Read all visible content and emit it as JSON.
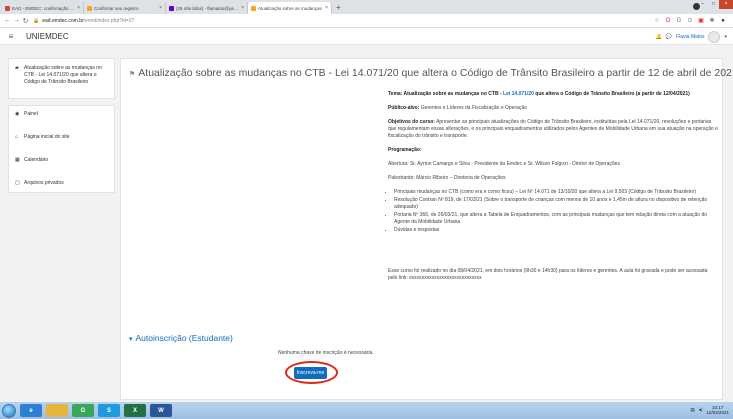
{
  "browser": {
    "tabs": [
      {
        "title": "EAD - EMDEC: confirmação de c",
        "favicon_color": "#d44638",
        "active": false
      },
      {
        "title": "Confirmar seu registro",
        "favicon_color": "#f5a623",
        "active": false
      },
      {
        "title": "(25 não lidos) - flamatos@yahoo",
        "favicon_color": "#5f01d1",
        "active": false
      },
      {
        "title": "Atualização sobre as mudanças",
        "favicon_color": "#f5a623",
        "active": true
      }
    ],
    "new_tab": "+",
    "url_host": "ead.emdec.com.br",
    "url_path": "/enrol/index.php?id=27"
  },
  "navbar": {
    "brand": "UNIEMDEC",
    "user_name": "Flavia Matos"
  },
  "sidebar": {
    "course_item": "Atualização sobre as mudanças no CTB - Lei 14.071/20 que altera o Código de Trânsito Brasileiro",
    "nav_items": [
      {
        "label": "Painel",
        "icon": "dashboard-icon",
        "glyph": "◉"
      },
      {
        "label": "Página inicial do site",
        "icon": "home-icon",
        "glyph": "⌂"
      },
      {
        "label": "Calendário",
        "icon": "calendar-icon",
        "glyph": "▦"
      },
      {
        "label": "Arquivos privados",
        "icon": "file-icon",
        "glyph": "▢"
      }
    ]
  },
  "main": {
    "title": "Atualização sobre as mudanças no CTB - Lei 14.071/20 que altera o Código de Trânsito Brasileiro a partir de 12 de abril de 2021",
    "tema_label": "Tema: Atualização sobre as mudanças no CTB - ",
    "tema_link": "Lei 14.071/20",
    "tema_rest": " que altera o Código de Trânsito Brasileiro (a partir de 12/04/2021)",
    "publico_label": "Público-alvo:",
    "publico_text": " Gerentes e Líderes da Fiscalização e Operação",
    "objetivos_label": "Objetivos do curso:",
    "objetivos_text": " Apresentar as principais atualizações do Código de Trânsito Brasileiro, instituídas pela Lei 14.071/20, resoluções e portarias que regulamentam essas alterações, e os principais enquadramentos utilizados pelos Agentes de Mobilidade Urbana em sua atuação na operação e fiscalização do trânsito e transporte.",
    "programacao_label": "Programação:",
    "abertura": "Abertura: Sr. Ayrton Camargo e Silva - Presidente da Emdec e Sr. Wilson Folgozi - Diretor de Operações",
    "palestrante": "Palestrante: Márcio Ribeiro – Diretoria de Operações",
    "bullets": [
      "Principais mudanças no CTB (como era e como ficou) – Lei Nº 14.071 de 13/10/20 que altera a Lei 9.503 (Código de Trânsito Brasileiro)",
      "Resolução Contran Nº 819, de 17/03/21 (Sobre o transporte de crianças com menos de 10 anos e 1,45m de altura no dispositivo de retenção adequado)",
      "Portaria Nº 366, de 26/03/21, que altera a Tabela de Enquadramentos, com as principais mudanças que tem relação direta com a atuação do Agente da Mobilidade Urbana",
      "Dúvidas e respostas"
    ],
    "footer_text": "Esse curso foi realizado no dia 08/04/2021, em dois horários (9h30 e 14h30) para os líderes e gerentes. A aula foi gravada e pode ser acessada pelo link: xxxxxxxxxxxxxxxxxxxxxxxxxxxxx",
    "section_title": "Autoinscrição (Estudante)",
    "no_key_text": "Nenhuma chave de inscrição é necessária.",
    "enrol_button": "Inscreva-me"
  },
  "taskbar": {
    "time": "10:17",
    "date": "12/04/2021"
  },
  "colors": {
    "link": "#0f6cbf",
    "highlight_ring": "#e0251b"
  }
}
